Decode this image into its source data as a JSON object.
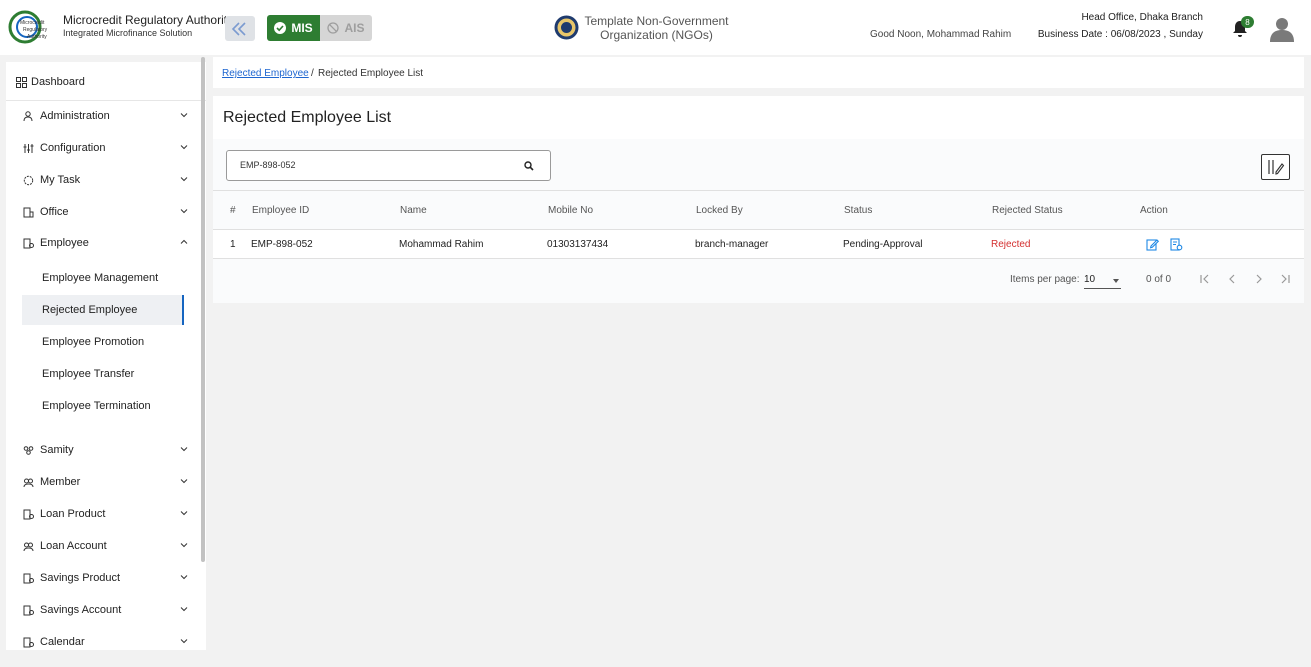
{
  "header": {
    "brand_title": "Microcredit Regulatory Authority",
    "brand_subtitle": "Integrated Microfinance Solution",
    "logo_text": [
      "Microcredit",
      "Regulatory",
      "Authority"
    ],
    "mis_label": "MIS",
    "ais_label": "AIS",
    "org_name": "Template Non-Government Organization (NGOs)",
    "greeting": "Good Noon, Mohammad Rahim",
    "branch": "Head Office, Dhaka Branch",
    "business_date": "Business Date : 06/08/2023 , Sunday",
    "notification_count": "8",
    "colors": {
      "brand_green": "#2e7d32",
      "link_blue": "#1e66d0",
      "rejected_red": "#d32f2f"
    }
  },
  "sidebar": {
    "dashboard": "Dashboard",
    "items": [
      {
        "label": "Administration",
        "icon": "admin-icon"
      },
      {
        "label": "Configuration",
        "icon": "sliders-icon"
      },
      {
        "label": "My Task",
        "icon": "task-icon"
      },
      {
        "label": "Office",
        "icon": "office-icon"
      },
      {
        "label": "Employee",
        "icon": "employee-icon"
      }
    ],
    "employee_sub": [
      "Employee Management",
      "Rejected Employee",
      "Employee Promotion",
      "Employee Transfer",
      "Employee Termination"
    ],
    "items_after": [
      {
        "label": "Samity",
        "icon": "samity-icon"
      },
      {
        "label": "Member",
        "icon": "member-icon"
      },
      {
        "label": "Loan Product",
        "icon": "loan-product-icon"
      },
      {
        "label": "Loan Account",
        "icon": "loan-account-icon"
      },
      {
        "label": "Savings Product",
        "icon": "savings-product-icon"
      },
      {
        "label": "Savings Account",
        "icon": "savings-account-icon"
      },
      {
        "label": "Calendar",
        "icon": "calendar-icon"
      }
    ]
  },
  "breadcrumb": {
    "link": "Rejected Employee",
    "separator": "/",
    "current": "Rejected Employee List"
  },
  "page": {
    "title": "Rejected Employee List",
    "search_value": "EMP-898-052"
  },
  "table": {
    "headers": [
      "#",
      "Employee ID",
      "Name",
      "Mobile No",
      "Locked By",
      "Status",
      "Rejected Status",
      "Action"
    ],
    "rows": [
      {
        "index": "1",
        "employee_id": "EMP-898-052",
        "name": "Mohammad Rahim",
        "mobile": "01303137434",
        "locked_by": "branch-manager",
        "status": "Pending-Approval",
        "rejected_status": "Rejected"
      }
    ]
  },
  "pagination": {
    "items_per_page_label": "Items per page:",
    "items_per_page": "10",
    "range": "0 of 0"
  }
}
